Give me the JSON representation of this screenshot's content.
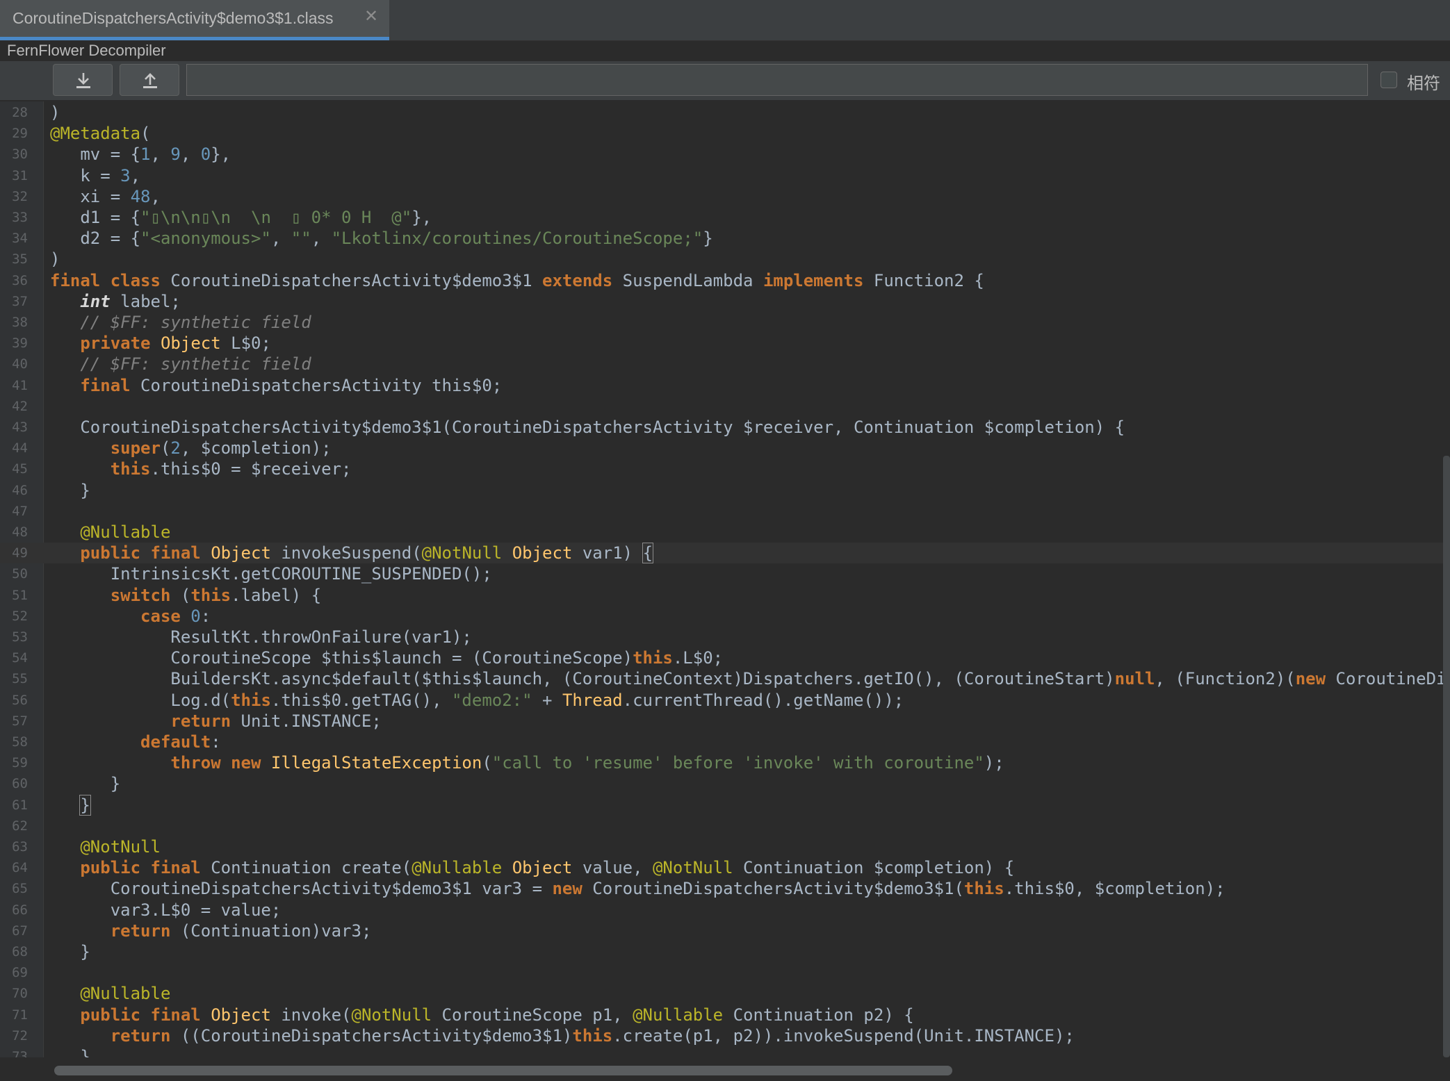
{
  "tab": {
    "title": "CoroutineDispatchersActivity$demo3$1.class",
    "close": "✕"
  },
  "decompiler_label": "FernFlower Decompiler",
  "toolbar": {
    "download_icon": "download-icon",
    "upload_icon": "upload-icon",
    "search_value": "",
    "match_label": "相符",
    "match_checked": false
  },
  "colors": {
    "keyword": "#cc7832",
    "annotation": "#bbb529",
    "number": "#6897bb",
    "string": "#6a8759",
    "comment": "#808080",
    "plain": "#a9b7c6",
    "method": "#ffc66d",
    "accent": "#4a88c7"
  },
  "editor": {
    "current_line": 49,
    "lines": [
      {
        "n": 28,
        "t": [
          {
            "s": ")"
          }
        ]
      },
      {
        "n": 29,
        "t": [
          {
            "s": "@Metadata",
            "c": "ann"
          },
          {
            "s": "("
          }
        ]
      },
      {
        "n": 30,
        "t": [
          {
            "s": "   mv = {"
          },
          {
            "s": "1",
            "c": "num"
          },
          {
            "s": ", "
          },
          {
            "s": "9",
            "c": "num"
          },
          {
            "s": ", "
          },
          {
            "s": "0",
            "c": "num"
          },
          {
            "s": "},"
          }
        ]
      },
      {
        "n": 31,
        "t": [
          {
            "s": "   k = "
          },
          {
            "s": "3",
            "c": "num"
          },
          {
            "s": ","
          }
        ]
      },
      {
        "n": 32,
        "t": [
          {
            "s": "   xi = "
          },
          {
            "s": "48",
            "c": "num"
          },
          {
            "s": ","
          }
        ]
      },
      {
        "n": 33,
        "t": [
          {
            "s": "   d1 = {"
          },
          {
            "s": "\"▯\\n\\n▯\\n  \\n  ▯ 0* 0 H  @\"",
            "c": "str"
          },
          {
            "s": "},"
          }
        ]
      },
      {
        "n": 34,
        "t": [
          {
            "s": "   d2 = {"
          },
          {
            "s": "\"<anonymous>\"",
            "c": "str"
          },
          {
            "s": ", "
          },
          {
            "s": "\"\"",
            "c": "str"
          },
          {
            "s": ", "
          },
          {
            "s": "\"Lkotlinx/coroutines/CoroutineScope;\"",
            "c": "str"
          },
          {
            "s": "}"
          }
        ]
      },
      {
        "n": 35,
        "t": [
          {
            "s": ")"
          }
        ]
      },
      {
        "n": 36,
        "t": [
          {
            "s": "final class",
            "c": "kw"
          },
          {
            "s": " CoroutineDispatchersActivity$demo3$1 "
          },
          {
            "s": "extends",
            "c": "kw"
          },
          {
            "s": " SuspendLambda "
          },
          {
            "s": "implements",
            "c": "kw"
          },
          {
            "s": " Function2 {"
          }
        ]
      },
      {
        "n": 37,
        "t": [
          {
            "s": "   "
          },
          {
            "s": "int",
            "c": "kwi"
          },
          {
            "s": " label;"
          }
        ]
      },
      {
        "n": 38,
        "t": [
          {
            "s": "   "
          },
          {
            "s": "// $FF: synthetic field",
            "c": "cmt"
          }
        ]
      },
      {
        "n": 39,
        "t": [
          {
            "s": "   "
          },
          {
            "s": "private",
            "c": "kw"
          },
          {
            "s": " "
          },
          {
            "s": "Object",
            "c": "cls"
          },
          {
            "s": " L$0;"
          }
        ]
      },
      {
        "n": 40,
        "t": [
          {
            "s": "   "
          },
          {
            "s": "// $FF: synthetic field",
            "c": "cmt"
          }
        ]
      },
      {
        "n": 41,
        "t": [
          {
            "s": "   "
          },
          {
            "s": "final",
            "c": "kw"
          },
          {
            "s": " CoroutineDispatchersActivity this$0;"
          }
        ]
      },
      {
        "n": 42,
        "t": [
          {
            "s": ""
          }
        ]
      },
      {
        "n": 43,
        "t": [
          {
            "s": "   CoroutineDispatchersActivity$demo3$1(CoroutineDispatchersActivity $receiver, Continuation $completion) {"
          }
        ]
      },
      {
        "n": 44,
        "t": [
          {
            "s": "      "
          },
          {
            "s": "super",
            "c": "kw"
          },
          {
            "s": "("
          },
          {
            "s": "2",
            "c": "num"
          },
          {
            "s": ", $completion);"
          }
        ]
      },
      {
        "n": 45,
        "t": [
          {
            "s": "      "
          },
          {
            "s": "this",
            "c": "kw"
          },
          {
            "s": ".this$0 = $receiver;"
          }
        ]
      },
      {
        "n": 46,
        "t": [
          {
            "s": "   }"
          }
        ]
      },
      {
        "n": 47,
        "t": [
          {
            "s": ""
          }
        ]
      },
      {
        "n": 48,
        "t": [
          {
            "s": "   "
          },
          {
            "s": "@Nullable",
            "c": "ann"
          }
        ]
      },
      {
        "n": 49,
        "t": [
          {
            "s": "   "
          },
          {
            "s": "public final",
            "c": "kw"
          },
          {
            "s": " "
          },
          {
            "s": "Object",
            "c": "cls"
          },
          {
            "s": " invokeSuspend("
          },
          {
            "s": "@NotNull",
            "c": "ann"
          },
          {
            "s": " "
          },
          {
            "s": "Object",
            "c": "cls"
          },
          {
            "s": " var1) "
          },
          {
            "s": "{",
            "c": "bhl"
          }
        ]
      },
      {
        "n": 50,
        "t": [
          {
            "s": "      IntrinsicsKt.getCOROUTINE_SUSPENDED();"
          }
        ]
      },
      {
        "n": 51,
        "t": [
          {
            "s": "      "
          },
          {
            "s": "switch",
            "c": "kw"
          },
          {
            "s": " ("
          },
          {
            "s": "this",
            "c": "kw"
          },
          {
            "s": ".label) {"
          }
        ]
      },
      {
        "n": 52,
        "t": [
          {
            "s": "         "
          },
          {
            "s": "case",
            "c": "kw"
          },
          {
            "s": " "
          },
          {
            "s": "0",
            "c": "num"
          },
          {
            "s": ":"
          }
        ]
      },
      {
        "n": 53,
        "t": [
          {
            "s": "            ResultKt.throwOnFailure(var1);"
          }
        ]
      },
      {
        "n": 54,
        "t": [
          {
            "s": "            CoroutineScope $this$launch = (CoroutineScope)"
          },
          {
            "s": "this",
            "c": "kw"
          },
          {
            "s": ".L$0;"
          }
        ]
      },
      {
        "n": 55,
        "t": [
          {
            "s": "            BuildersKt.async$default($this$launch, (CoroutineContext)Dispatchers.getIO(), (CoroutineStart)"
          },
          {
            "s": "null",
            "c": "kw"
          },
          {
            "s": ", (Function2)("
          },
          {
            "s": "new",
            "c": "kw"
          },
          {
            "s": " CoroutineDispat"
          }
        ]
      },
      {
        "n": 56,
        "t": [
          {
            "s": "            Log.d("
          },
          {
            "s": "this",
            "c": "kw"
          },
          {
            "s": ".this$0.getTAG(), "
          },
          {
            "s": "\"demo2:\"",
            "c": "str"
          },
          {
            "s": " + "
          },
          {
            "s": "Thread",
            "c": "cls"
          },
          {
            "s": ".currentThread().getName());"
          }
        ]
      },
      {
        "n": 57,
        "t": [
          {
            "s": "            "
          },
          {
            "s": "return",
            "c": "kw"
          },
          {
            "s": " Unit.INSTANCE;"
          }
        ]
      },
      {
        "n": 58,
        "t": [
          {
            "s": "         "
          },
          {
            "s": "default",
            "c": "kw"
          },
          {
            "s": ":"
          }
        ]
      },
      {
        "n": 59,
        "t": [
          {
            "s": "            "
          },
          {
            "s": "throw new",
            "c": "kw"
          },
          {
            "s": " "
          },
          {
            "s": "IllegalStateException",
            "c": "cls"
          },
          {
            "s": "("
          },
          {
            "s": "\"call to 'resume' before 'invoke' with coroutine\"",
            "c": "str"
          },
          {
            "s": ");"
          }
        ]
      },
      {
        "n": 60,
        "t": [
          {
            "s": "      }"
          }
        ]
      },
      {
        "n": 61,
        "t": [
          {
            "s": "   "
          },
          {
            "s": "}",
            "c": "bhl"
          }
        ]
      },
      {
        "n": 62,
        "t": [
          {
            "s": ""
          }
        ]
      },
      {
        "n": 63,
        "t": [
          {
            "s": "   "
          },
          {
            "s": "@NotNull",
            "c": "ann"
          }
        ]
      },
      {
        "n": 64,
        "t": [
          {
            "s": "   "
          },
          {
            "s": "public final",
            "c": "kw"
          },
          {
            "s": " Continuation create("
          },
          {
            "s": "@Nullable",
            "c": "ann"
          },
          {
            "s": " "
          },
          {
            "s": "Object",
            "c": "cls"
          },
          {
            "s": " value, "
          },
          {
            "s": "@NotNull",
            "c": "ann"
          },
          {
            "s": " Continuation $completion) {"
          }
        ]
      },
      {
        "n": 65,
        "t": [
          {
            "s": "      CoroutineDispatchersActivity$demo3$1 var3 = "
          },
          {
            "s": "new",
            "c": "kw"
          },
          {
            "s": " CoroutineDispatchersActivity$demo3$1("
          },
          {
            "s": "this",
            "c": "kw"
          },
          {
            "s": ".this$0, $completion);"
          }
        ]
      },
      {
        "n": 66,
        "t": [
          {
            "s": "      var3.L$0 = value;"
          }
        ]
      },
      {
        "n": 67,
        "t": [
          {
            "s": "      "
          },
          {
            "s": "return",
            "c": "kw"
          },
          {
            "s": " (Continuation)var3;"
          }
        ]
      },
      {
        "n": 68,
        "t": [
          {
            "s": "   }"
          }
        ]
      },
      {
        "n": 69,
        "t": [
          {
            "s": ""
          }
        ]
      },
      {
        "n": 70,
        "t": [
          {
            "s": "   "
          },
          {
            "s": "@Nullable",
            "c": "ann"
          }
        ]
      },
      {
        "n": 71,
        "t": [
          {
            "s": "   "
          },
          {
            "s": "public final",
            "c": "kw"
          },
          {
            "s": " "
          },
          {
            "s": "Object",
            "c": "cls"
          },
          {
            "s": " invoke("
          },
          {
            "s": "@NotNull",
            "c": "ann"
          },
          {
            "s": " CoroutineScope p1, "
          },
          {
            "s": "@Nullable",
            "c": "ann"
          },
          {
            "s": " Continuation p2) {"
          }
        ]
      },
      {
        "n": 72,
        "t": [
          {
            "s": "      "
          },
          {
            "s": "return",
            "c": "kw"
          },
          {
            "s": " ((CoroutineDispatchersActivity$demo3$1)"
          },
          {
            "s": "this",
            "c": "kw"
          },
          {
            "s": ".create(p1, p2)).invokeSuspend(Unit.INSTANCE);"
          }
        ]
      },
      {
        "n": 73,
        "t": [
          {
            "s": "   }"
          }
        ]
      }
    ]
  }
}
